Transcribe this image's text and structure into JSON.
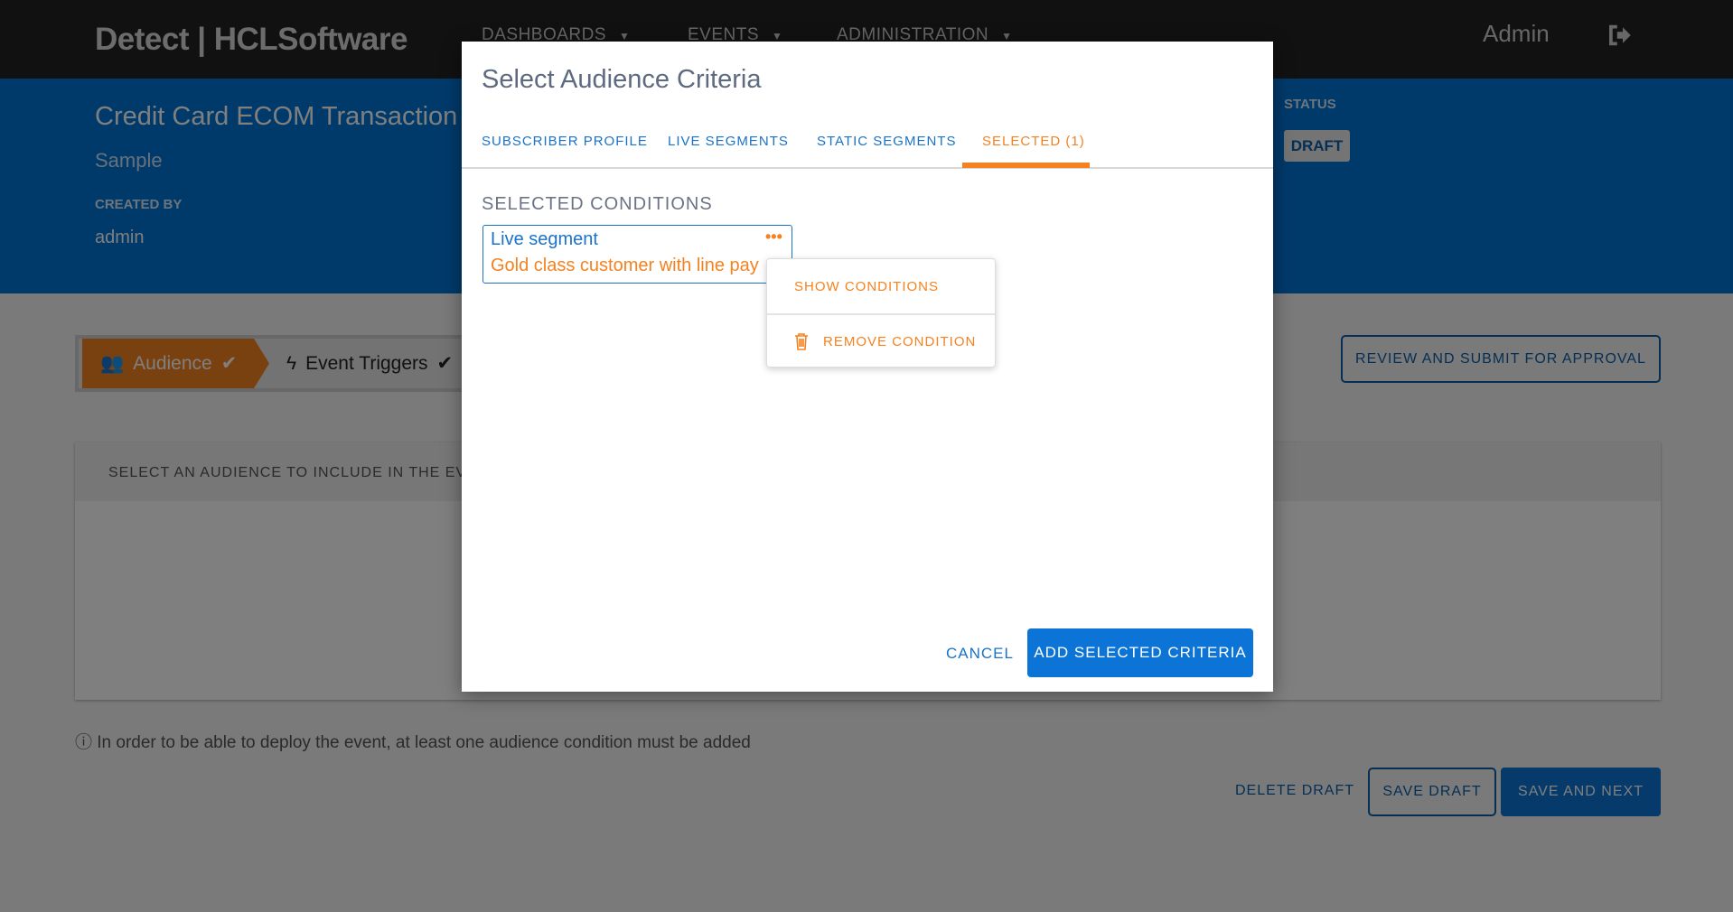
{
  "topbar": {
    "logo": "Detect | HCLSoftware",
    "nav": [
      "DASHBOARDS",
      "EVENTS",
      "ADMINISTRATION"
    ],
    "user": "Admin"
  },
  "event": {
    "title": "Credit Card ECOM Transaction",
    "subtitle": "Sample",
    "created_by_label": "CREATED BY",
    "created_by": "admin",
    "status_label": "STATUS",
    "status": "DRAFT"
  },
  "stepper": {
    "steps": [
      "Audience",
      "Event Triggers"
    ]
  },
  "review_button": "REVIEW AND SUBMIT FOR APPROVAL",
  "panel": {
    "heading": "SELECT AN AUDIENCE TO INCLUDE IN THE EVENT"
  },
  "info": "In order to be able to deploy the event, at least one audience condition must be added",
  "footer": {
    "delete": "DELETE DRAFT",
    "save": "SAVE DRAFT",
    "next": "SAVE AND NEXT"
  },
  "modal": {
    "title": "Select Audience Criteria",
    "tabs": [
      "SUBSCRIBER PROFILE",
      "LIVE SEGMENTS",
      "STATIC SEGMENTS",
      "SELECTED (1)"
    ],
    "section": "SELECTED CONDITIONS",
    "condition": {
      "type": "Live segment",
      "name": "Gold class customer with line pay"
    },
    "menu": [
      "SHOW CONDITIONS",
      "REMOVE CONDITION"
    ],
    "cancel": "CANCEL",
    "add": "ADD SELECTED CRITERIA"
  },
  "colors": {
    "accent": "#f58220",
    "primary": "#0b74d6"
  }
}
